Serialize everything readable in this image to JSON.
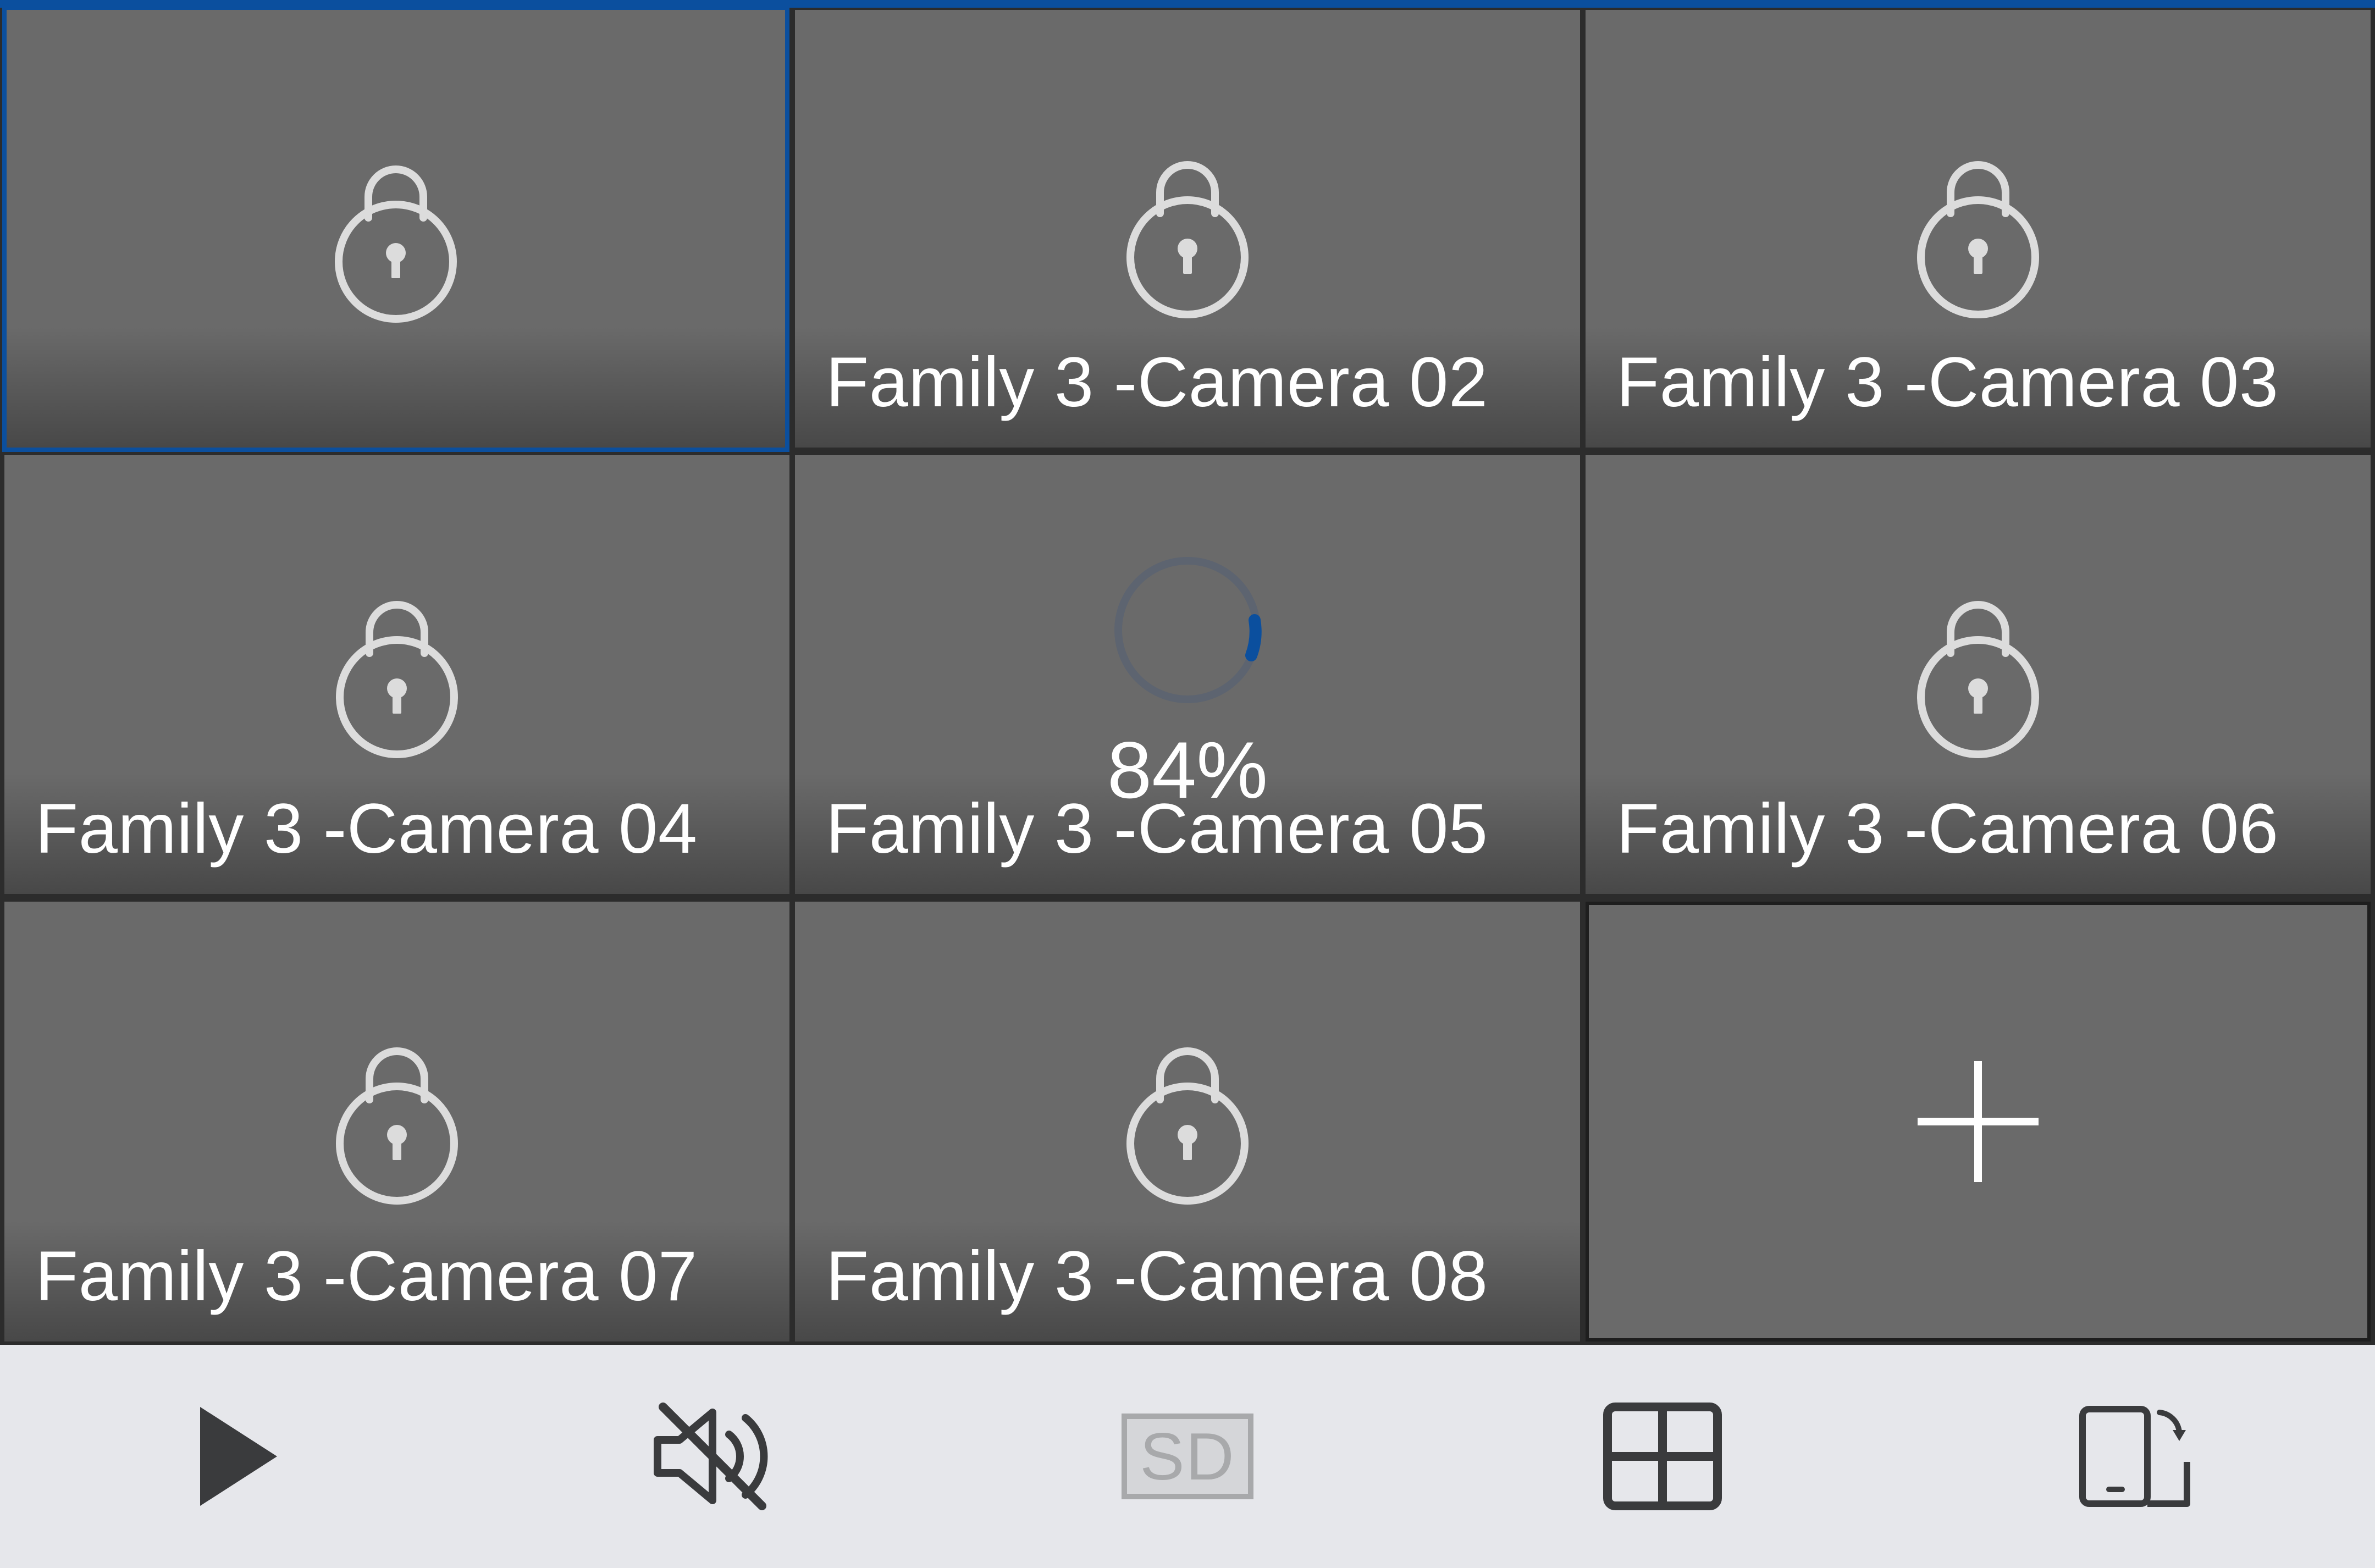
{
  "cameras": [
    {
      "label": "",
      "state": "locked",
      "selected": true
    },
    {
      "label": "Family 3 -Camera 02",
      "state": "locked"
    },
    {
      "label": "Family 3 -Camera 03",
      "state": "locked"
    },
    {
      "label": "Family 3 -Camera 04",
      "state": "locked"
    },
    {
      "label": "Family 3 -Camera 05",
      "state": "loading",
      "progress_text": "84%",
      "progress": 0.84
    },
    {
      "label": "Family 3 -Camera 06",
      "state": "locked"
    },
    {
      "label": "Family 3 -Camera 07",
      "state": "locked"
    },
    {
      "label": "Family 3 -Camera 08",
      "state": "locked"
    },
    {
      "label": "",
      "state": "add",
      "icon": "plus-icon"
    }
  ],
  "toolbar": {
    "items": [
      {
        "icon": "play-icon"
      },
      {
        "icon": "mute-icon"
      },
      {
        "icon": "sd-icon",
        "text": "SD",
        "disabled": true
      },
      {
        "icon": "grid-layout-icon"
      },
      {
        "icon": "rotate-screen-icon"
      }
    ]
  },
  "colors": {
    "accent": "#0b4f9e",
    "tile_bg": "#6a6a6a",
    "grid_gap": "#2c2c2c",
    "toolbar_bg": "#e6e7eb",
    "icon": "#3a3b3d",
    "icon_disabled": "#a8a9ab",
    "lock": "#dcdcdc"
  }
}
